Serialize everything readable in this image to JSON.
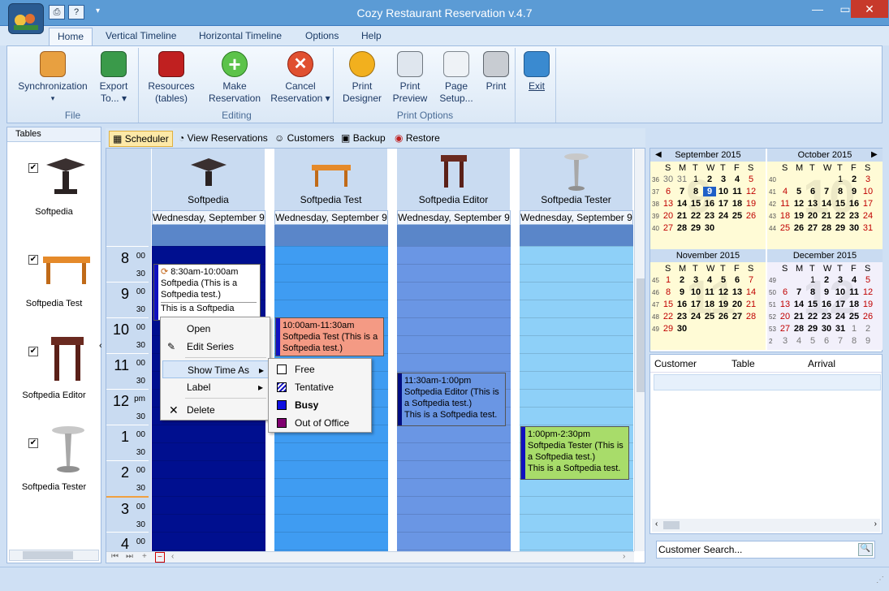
{
  "window": {
    "title": "Cozy Restaurant Reservation v.4.7"
  },
  "menu_tabs": [
    {
      "label": "Home"
    },
    {
      "label": "Vertical Timeline"
    },
    {
      "label": "Horizontal Timeline"
    },
    {
      "label": "Options"
    },
    {
      "label": "Help"
    }
  ],
  "ribbon": {
    "file": {
      "label": "File",
      "sync": "Synchronization",
      "sync_sub": "▾",
      "export": "Export",
      "export2": "To... ▾"
    },
    "editing": {
      "label": "Editing",
      "res": "Resources",
      "res2": "(tables)",
      "make": "Make",
      "make2": "Reservation",
      "cancel": "Cancel",
      "cancel2": "Reservation ▾"
    },
    "print": {
      "label": "Print Options",
      "designer": "Print",
      "designer2": "Designer",
      "preview": "Print",
      "preview2": "Preview",
      "setup": "Page",
      "setup2": "Setup...",
      "print": "Print"
    },
    "exit": {
      "label": "Exit"
    }
  },
  "tables_pane": {
    "header": "Tables",
    "items": [
      {
        "name": "Softpedia",
        "checked": "✔"
      },
      {
        "name": "Softpedia Test",
        "checked": "✔"
      },
      {
        "name": "Softpedia Editor",
        "checked": "✔"
      },
      {
        "name": "Softpedia Tester",
        "checked": "✔"
      }
    ]
  },
  "view_tabs": [
    {
      "label": "Scheduler"
    },
    {
      "label": "View Reservations"
    },
    {
      "label": "Customers"
    },
    {
      "label": "Backup"
    },
    {
      "label": "Restore"
    }
  ],
  "scheduler": {
    "resources": [
      {
        "name": "Softpedia",
        "date": "Wednesday, September 9"
      },
      {
        "name": "Softpedia Test",
        "date": "Wednesday, September 9"
      },
      {
        "name": "Softpedia Editor",
        "date": "Wednesday, September 9"
      },
      {
        "name": "Softpedia Tester",
        "date": "Wednesday, September 9"
      }
    ],
    "hours": [
      {
        "h": "8",
        "m": "00",
        "m2": "30"
      },
      {
        "h": "9",
        "m": "00",
        "m2": "30"
      },
      {
        "h": "10",
        "m": "00",
        "m2": "30"
      },
      {
        "h": "11",
        "m": "00",
        "m2": "30"
      },
      {
        "h": "12",
        "m": "pm",
        "m2": "30"
      },
      {
        "h": "1",
        "m": "00",
        "m2": "30"
      },
      {
        "h": "2",
        "m": "00",
        "m2": "30"
      },
      {
        "h": "3",
        "m": "00",
        "m2": "30"
      },
      {
        "h": "4",
        "m": "00",
        "m2": ""
      }
    ],
    "appointments": [
      {
        "time": "8:30am-10:00am",
        "title": "Softpedia (This is a Softpedia test.)",
        "note": "This is a Softpedia"
      },
      {
        "time": "10:00am-11:30am",
        "title": "Softpedia Test (This is a Softpedia test.)",
        "note": ""
      },
      {
        "time": "11:30am-1:00pm",
        "title": "Softpedia Editor (This is a Softpedia test.)",
        "note": "This is a Softpedia test."
      },
      {
        "time": "1:00pm-2:30pm",
        "title": "Softpedia Tester (This is a Softpedia test.)",
        "note": "This is a Softpedia test."
      }
    ]
  },
  "context_menu": {
    "items": [
      "Open",
      "Edit Series",
      "Show Time As",
      "Label",
      "Delete"
    ],
    "submenu": [
      "Free",
      "Tentative",
      "Busy",
      "Out of Office"
    ],
    "submenu_arrow": "▸"
  },
  "calendar": {
    "dow": [
      "S",
      "M",
      "T",
      "W",
      "T",
      "F",
      "S"
    ],
    "months": [
      {
        "name": "September 2015",
        "big": "9",
        "weeks": [
          {
            "wk": "36",
            "days": [
              "30",
              "31",
              "1",
              "2",
              "3",
              "4",
              "5"
            ]
          },
          {
            "wk": "37",
            "days": [
              "6",
              "7",
              "8",
              "9",
              "10",
              "11",
              "12"
            ]
          },
          {
            "wk": "38",
            "days": [
              "13",
              "14",
              "15",
              "16",
              "17",
              "18",
              "19"
            ]
          },
          {
            "wk": "39",
            "days": [
              "20",
              "21",
              "22",
              "23",
              "24",
              "25",
              "26"
            ]
          },
          {
            "wk": "40",
            "days": [
              "27",
              "28",
              "29",
              "30",
              "",
              "",
              ""
            ]
          }
        ]
      },
      {
        "name": "October 2015",
        "big": "10",
        "weeks": [
          {
            "wk": "40",
            "days": [
              "",
              "",
              "",
              "",
              "1",
              "2",
              "3"
            ]
          },
          {
            "wk": "41",
            "days": [
              "4",
              "5",
              "6",
              "7",
              "8",
              "9",
              "10"
            ]
          },
          {
            "wk": "42",
            "days": [
              "11",
              "12",
              "13",
              "14",
              "15",
              "16",
              "17"
            ]
          },
          {
            "wk": "43",
            "days": [
              "18",
              "19",
              "20",
              "21",
              "22",
              "23",
              "24"
            ]
          },
          {
            "wk": "44",
            "days": [
              "25",
              "26",
              "27",
              "28",
              "29",
              "30",
              "31"
            ]
          }
        ]
      },
      {
        "name": "November 2015",
        "big": "11",
        "weeks": [
          {
            "wk": "45",
            "days": [
              "1",
              "2",
              "3",
              "4",
              "5",
              "6",
              "7"
            ]
          },
          {
            "wk": "46",
            "days": [
              "8",
              "9",
              "10",
              "11",
              "12",
              "13",
              "14"
            ]
          },
          {
            "wk": "47",
            "days": [
              "15",
              "16",
              "17",
              "18",
              "19",
              "20",
              "21"
            ]
          },
          {
            "wk": "48",
            "days": [
              "22",
              "23",
              "24",
              "25",
              "26",
              "27",
              "28"
            ]
          },
          {
            "wk": "49",
            "days": [
              "29",
              "30",
              "",
              "",
              "",
              "",
              ""
            ]
          }
        ]
      },
      {
        "name": "December 2015",
        "big": "12",
        "weeks": [
          {
            "wk": "49",
            "days": [
              "",
              "",
              "1",
              "2",
              "3",
              "4",
              "5"
            ]
          },
          {
            "wk": "50",
            "days": [
              "6",
              "7",
              "8",
              "9",
              "10",
              "11",
              "12"
            ]
          },
          {
            "wk": "51",
            "days": [
              "13",
              "14",
              "15",
              "16",
              "17",
              "18",
              "19"
            ]
          },
          {
            "wk": "52",
            "days": [
              "20",
              "21",
              "22",
              "23",
              "24",
              "25",
              "26"
            ]
          },
          {
            "wk": "53",
            "days": [
              "27",
              "28",
              "29",
              "30",
              "31",
              "1",
              "2"
            ]
          },
          {
            "wk": "2",
            "days": [
              "3",
              "4",
              "5",
              "6",
              "7",
              "8",
              "9"
            ]
          }
        ]
      }
    ],
    "today": "9"
  },
  "reservation_list": {
    "columns": [
      "Customer",
      "Table",
      "Arrival"
    ]
  },
  "search": {
    "placeholder": "Customer Search..."
  }
}
